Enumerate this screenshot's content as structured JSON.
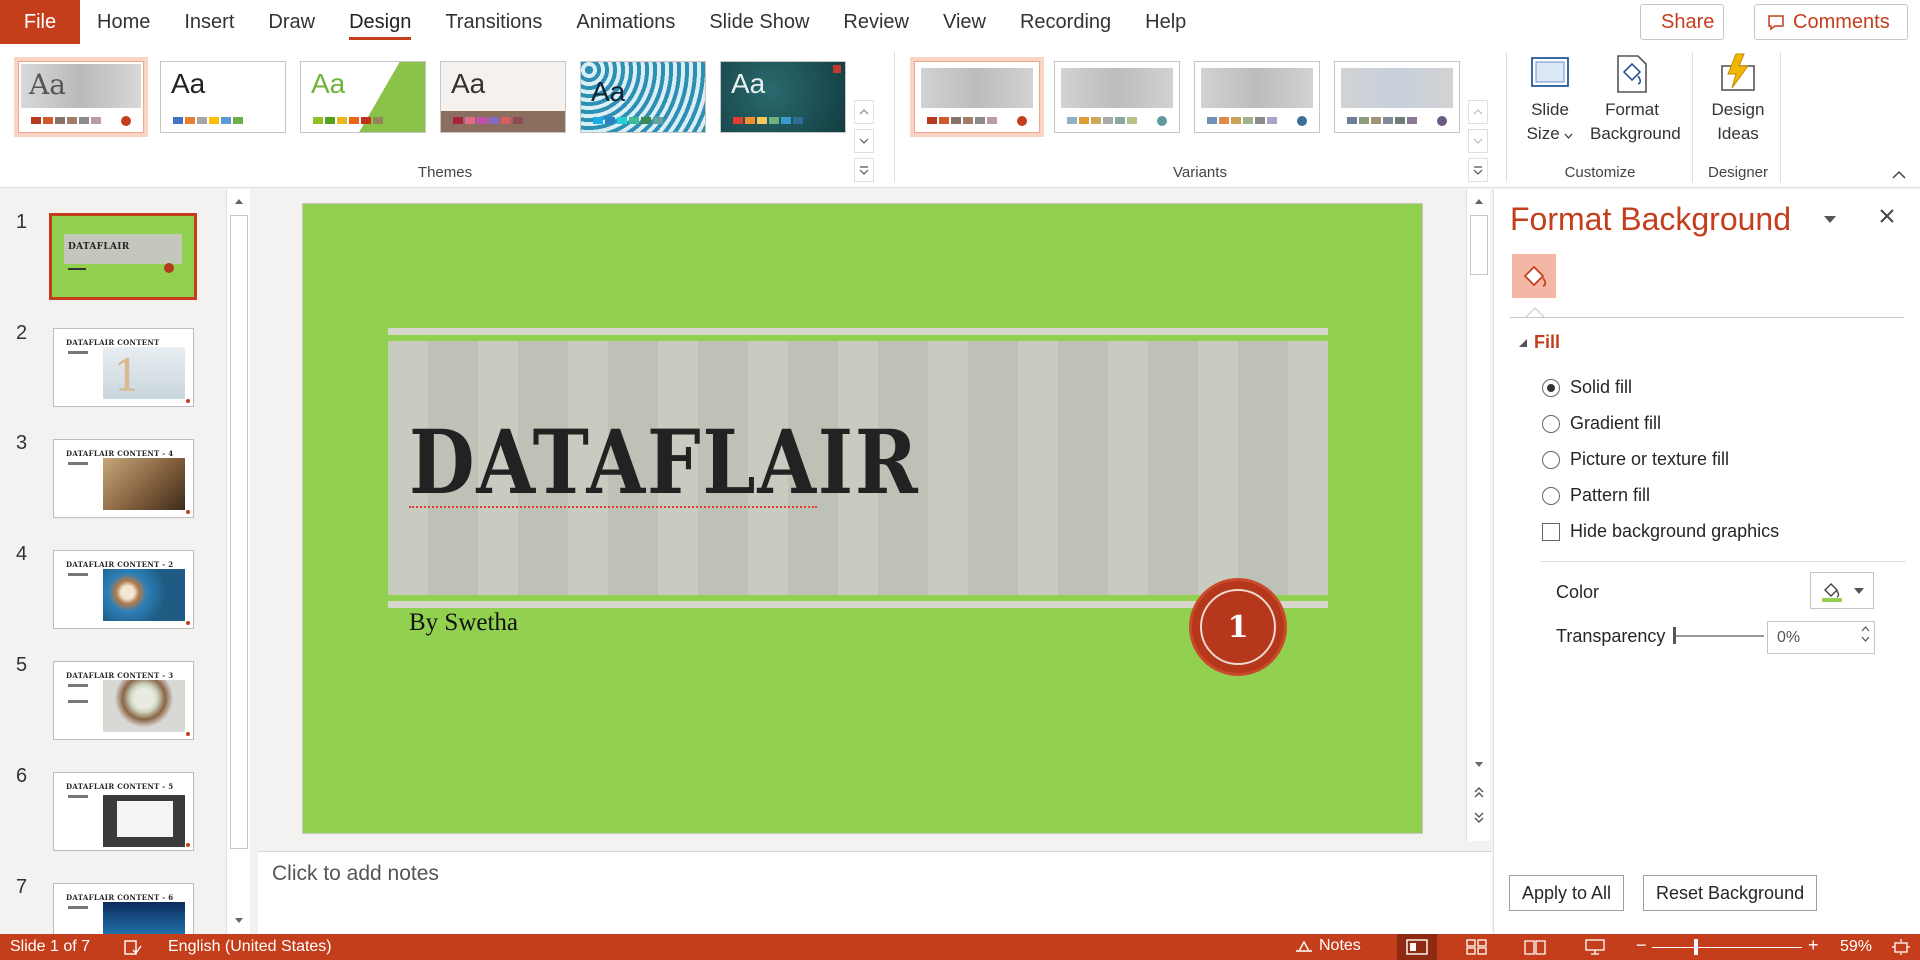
{
  "tabbar": {
    "file": "File",
    "tabs": [
      "Home",
      "Insert",
      "Draw",
      "Design",
      "Transitions",
      "Animations",
      "Slide Show",
      "Review",
      "View",
      "Recording",
      "Help"
    ],
    "active_tab": "Design",
    "share": "Share",
    "comments": "Comments"
  },
  "ribbon": {
    "themes_label": "Themes",
    "variants_label": "Variants",
    "customize_label": "Customize",
    "designer_label": "Designer",
    "theme_aa": "Aa",
    "slide_size_line1": "Slide",
    "slide_size_line2": "Size",
    "format_bg_line1": "Format",
    "format_bg_line2": "Background",
    "design_ideas_line1": "Design",
    "design_ideas_line2": "Ideas"
  },
  "slides": {
    "numbers": [
      "1",
      "2",
      "3",
      "4",
      "5",
      "6",
      "7"
    ],
    "thumb_titles": [
      "DATAFLAIR",
      "DATAFLAIR CONTENT",
      "DATAFLAIR CONTENT - 4",
      "DATAFLAIR CONTENT - 2",
      "DATAFLAIR CONTENT - 3",
      "DATAFLAIR CONTENT - 5",
      "DATAFLAIR CONTENT - 6"
    ]
  },
  "slide": {
    "title": "DATAFLAIR",
    "subtitle": "By Swetha",
    "badge": "1"
  },
  "notes": {
    "placeholder": "Click to add notes"
  },
  "pane": {
    "title": "Format Background",
    "section": "Fill",
    "options": {
      "solid": "Solid fill",
      "gradient": "Gradient fill",
      "picture": "Picture or texture fill",
      "pattern": "Pattern fill",
      "hide": "Hide background graphics"
    },
    "color_label": "Color",
    "transparency_label": "Transparency",
    "transparency_value": "0%",
    "apply_all": "Apply to All",
    "reset": "Reset Background"
  },
  "status": {
    "slide_info": "Slide 1 of 7",
    "language": "English (United States)",
    "notes": "Notes",
    "zoom": "59%"
  },
  "colors": {
    "accent": "#c43e1c",
    "slide_bg": "#92d050",
    "status_bar": "#c43e1c"
  }
}
